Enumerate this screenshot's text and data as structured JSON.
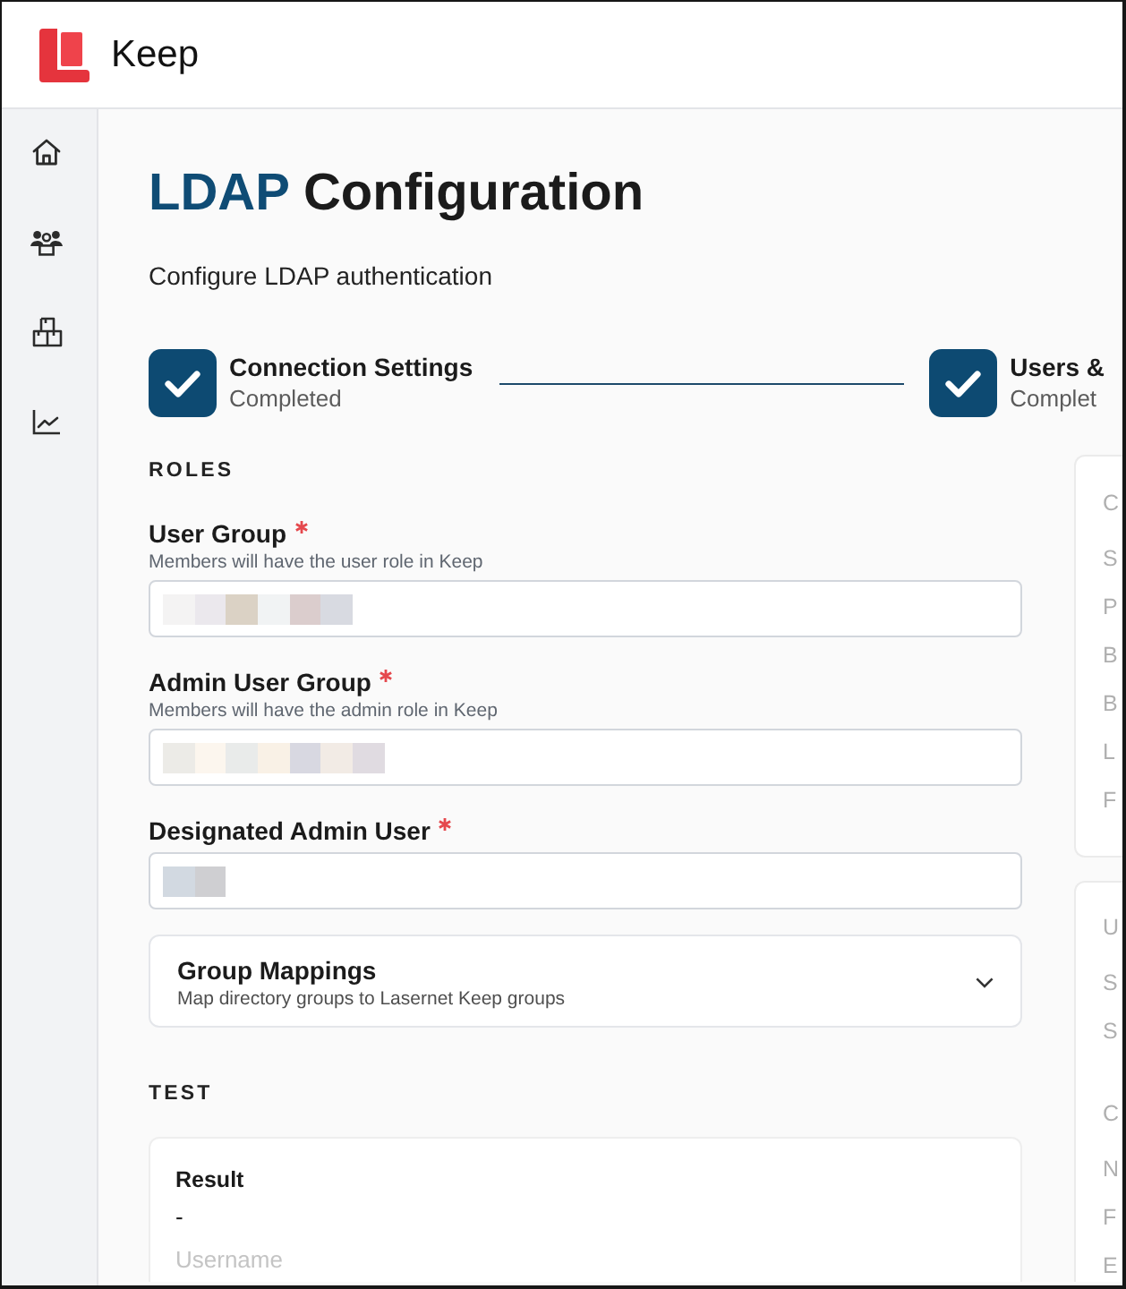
{
  "header": {
    "app_name": "Keep"
  },
  "sidebar": {
    "items": [
      {
        "kind": "home",
        "selected": false
      },
      {
        "kind": "users",
        "selected": false
      },
      {
        "kind": "packages",
        "selected": false
      },
      {
        "kind": "chart",
        "selected": false
      }
    ]
  },
  "page": {
    "title": {
      "accent": "LDAP",
      "text": "Configuration"
    },
    "subtitle": "Configure LDAP authentication"
  },
  "stepper": {
    "steps": [
      {
        "title": "Connection Settings",
        "status": "Completed",
        "completed": true
      },
      {
        "title": "Users &",
        "status": "Complet",
        "completed": true
      }
    ]
  },
  "roles": {
    "heading": "ROLES",
    "fields": [
      {
        "label": "User Group",
        "required": true,
        "hint": "Members will have the user role in Keep",
        "mosaic": [
          {
            "color": "#f4f3f3"
          },
          {
            "color": "#ebe8ed"
          },
          {
            "color": "#dbd2c5"
          },
          {
            "color": "#f1f3f4"
          },
          {
            "color": "#dbcdcd"
          },
          {
            "color": "#d8dae1"
          }
        ]
      },
      {
        "label": "Admin User Group",
        "required": true,
        "hint": "Members will have the admin role in Keep",
        "mosaic": [
          {
            "color": "#ecebe7"
          },
          {
            "color": "#fcf6ee"
          },
          {
            "color": "#e9ebea"
          },
          {
            "color": "#f9f1e6"
          },
          {
            "color": "#d8d8e1"
          },
          {
            "color": "#f2ebe5"
          },
          {
            "color": "#e0dbe1"
          }
        ]
      },
      {
        "label": "Designated Admin User",
        "required": true,
        "mosaic": [
          {
            "color": "#d2d9e1"
          },
          {
            "color": "#cfcfd2"
          }
        ]
      }
    ],
    "group_mappings": {
      "title": "Group Mappings",
      "description": "Map directory groups to Lasernet Keep groups",
      "expanded": false
    }
  },
  "test": {
    "heading": "TEST",
    "result": {
      "label": "Result",
      "value": "-"
    },
    "next_field_label": "Username"
  },
  "side_panels": [
    {
      "groups": [
        {
          "heading": "C",
          "rows": [
            "S",
            "P",
            "B",
            "B",
            "L",
            "F"
          ]
        }
      ]
    },
    {
      "groups": [
        {
          "heading": "U",
          "rows": [
            "S",
            "S"
          ]
        },
        {
          "heading": "C",
          "rows": [
            "N",
            "F",
            "E"
          ]
        }
      ]
    }
  ]
}
